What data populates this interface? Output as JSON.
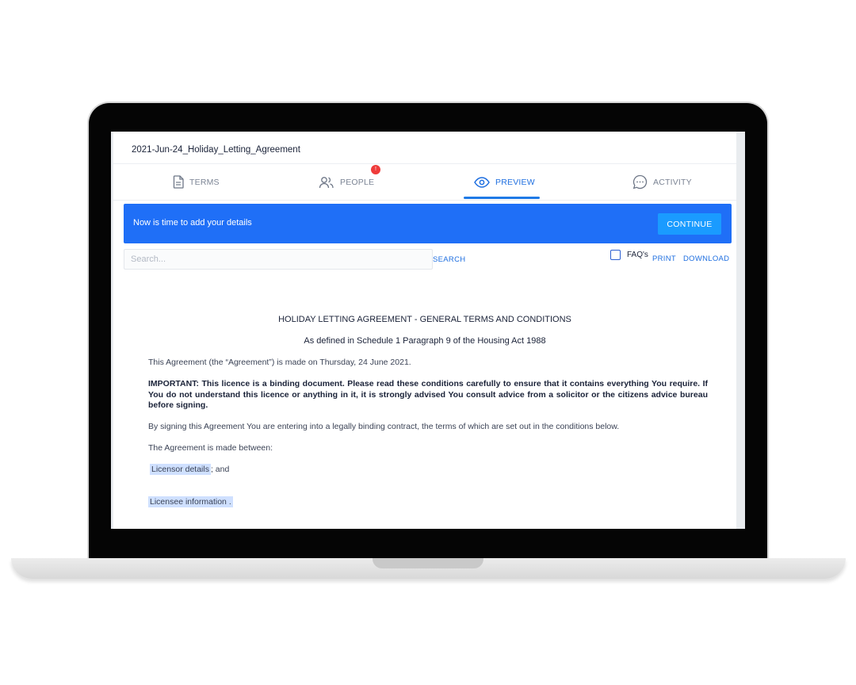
{
  "document": {
    "title": "2021-Jun-24_Holiday_Letting_Agreement"
  },
  "tabs": [
    {
      "label": "TERMS",
      "icon": "document-icon",
      "active": false
    },
    {
      "label": "PEOPLE",
      "icon": "people-icon",
      "active": false,
      "badge": "!"
    },
    {
      "label": "PREVIEW",
      "icon": "eye-icon",
      "active": true
    },
    {
      "label": "ACTIVITY",
      "icon": "chat-icon",
      "active": false
    }
  ],
  "banner": {
    "message": "Now is time to add your details",
    "button_label": "CONTINUE"
  },
  "search": {
    "placeholder": "Search...",
    "button_label": "SEARCH"
  },
  "toolbar": {
    "faq_label": "FAQ's",
    "print_label": "PRINT",
    "download_label": "DOWNLOAD"
  },
  "content": {
    "heading": "HOLIDAY LETTING AGREEMENT - GENERAL TERMS AND CONDITIONS",
    "subheading": "As defined in Schedule 1 Paragraph 9 of the Housing Act 1988",
    "intro": "This Agreement (the “Agreement”) is made on Thursday, 24 June 2021.",
    "important": "IMPORTANT: This licence is a binding document. Please read these conditions carefully to ensure that it contains everything You require. If You do not understand this licence or anything in it, it is strongly advised You consult advice from a solicitor or the citizens advice bureau before signing.",
    "signing": "By signing this Agreement You are entering into a legally binding contract, the terms of which are set out in the conditions below.",
    "between": "The Agreement is made between:",
    "licensor_field": "Licensor details",
    "licensor_suffix": "; and",
    "licensee_field": "Licensee information",
    "licensee_suffix": "."
  },
  "colors": {
    "accent": "#1f6ff7",
    "button": "#1a9bff",
    "badge": "#ef3b3b",
    "highlight": "#cfe0ff"
  }
}
